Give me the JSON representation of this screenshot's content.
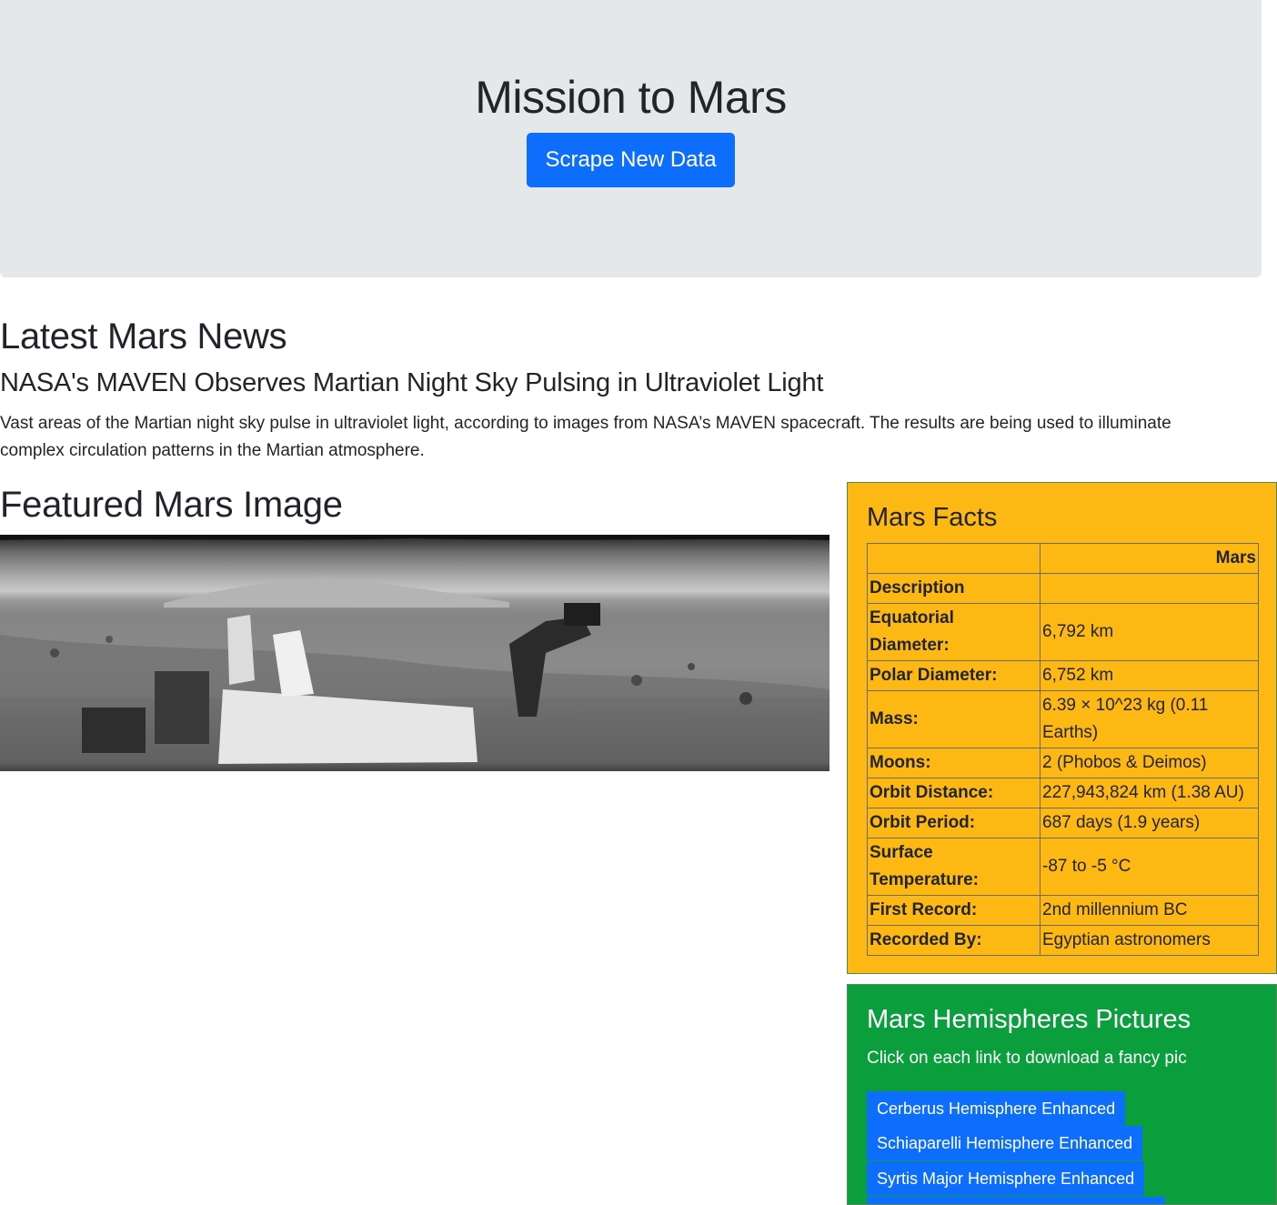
{
  "header": {
    "title": "Mission to Mars",
    "scrape_button": "Scrape New Data"
  },
  "news": {
    "heading": "Latest Mars News",
    "title": "NASA's MAVEN Observes Martian Night Sky Pulsing in Ultraviolet Light",
    "paragraph": "Vast areas of the Martian night sky pulse in ultraviolet light, according to images from NASA’s MAVEN spacecraft. The results are being used to illuminate complex circulation patterns in the Martian atmosphere."
  },
  "featured": {
    "heading": "Featured Mars Image"
  },
  "facts": {
    "heading": "Mars Facts",
    "column_header": "Mars",
    "rows": [
      {
        "label": "Description",
        "value": ""
      },
      {
        "label": "Equatorial Diameter:",
        "value": "6,792 km"
      },
      {
        "label": "Polar Diameter:",
        "value": "6,752 km"
      },
      {
        "label": "Mass:",
        "value": "6.39 × 10^23 kg (0.11 Earths)"
      },
      {
        "label": "Moons:",
        "value": "2 (Phobos & Deimos)"
      },
      {
        "label": "Orbit Distance:",
        "value": "227,943,824 km (1.38 AU)"
      },
      {
        "label": "Orbit Period:",
        "value": "687 days (1.9 years)"
      },
      {
        "label": "Surface Temperature:",
        "value": "-87 to -5 °C"
      },
      {
        "label": "First Record:",
        "value": "2nd millennium BC"
      },
      {
        "label": "Recorded By:",
        "value": "Egyptian astronomers"
      }
    ]
  },
  "hemispheres": {
    "heading": "Mars Hemispheres Pictures",
    "subtitle": "Click on each link to download a fancy pic",
    "links": [
      "Cerberus Hemisphere Enhanced",
      "Schiaparelli Hemisphere Enhanced",
      "Syrtis Major Hemisphere Enhanced"
    ]
  }
}
